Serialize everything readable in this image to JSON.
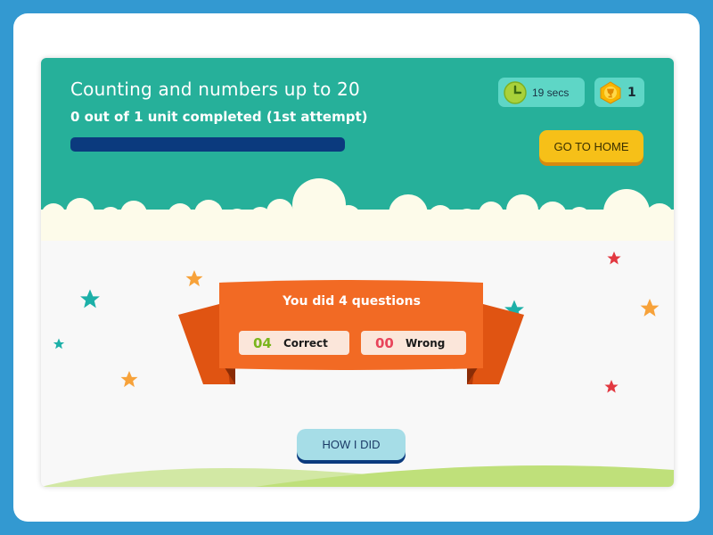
{
  "header": {
    "title": "Counting and numbers up to 20",
    "subtitle": "0 out of 1 unit completed (1st attempt)",
    "progress_fraction": 0,
    "timer_icon": "clock-icon",
    "timer_text": "19 secs",
    "coin_icon": "trophy-coin-icon",
    "coin_count": "1",
    "home_button_label": "GO TO HOME"
  },
  "result": {
    "heading": "You did 4 questions",
    "correct_count": "04",
    "correct_label": "Correct",
    "wrong_count": "00",
    "wrong_label": "Wrong"
  },
  "footer": {
    "how_button_label": "HOW I DID"
  },
  "colors": {
    "page_background": "#3399d1",
    "header_teal": "#26b09a",
    "ribbon_orange": "#f26a24",
    "correct_green": "#7ab51d",
    "wrong_red": "#e8445a",
    "button_yellow": "#f6c018"
  }
}
